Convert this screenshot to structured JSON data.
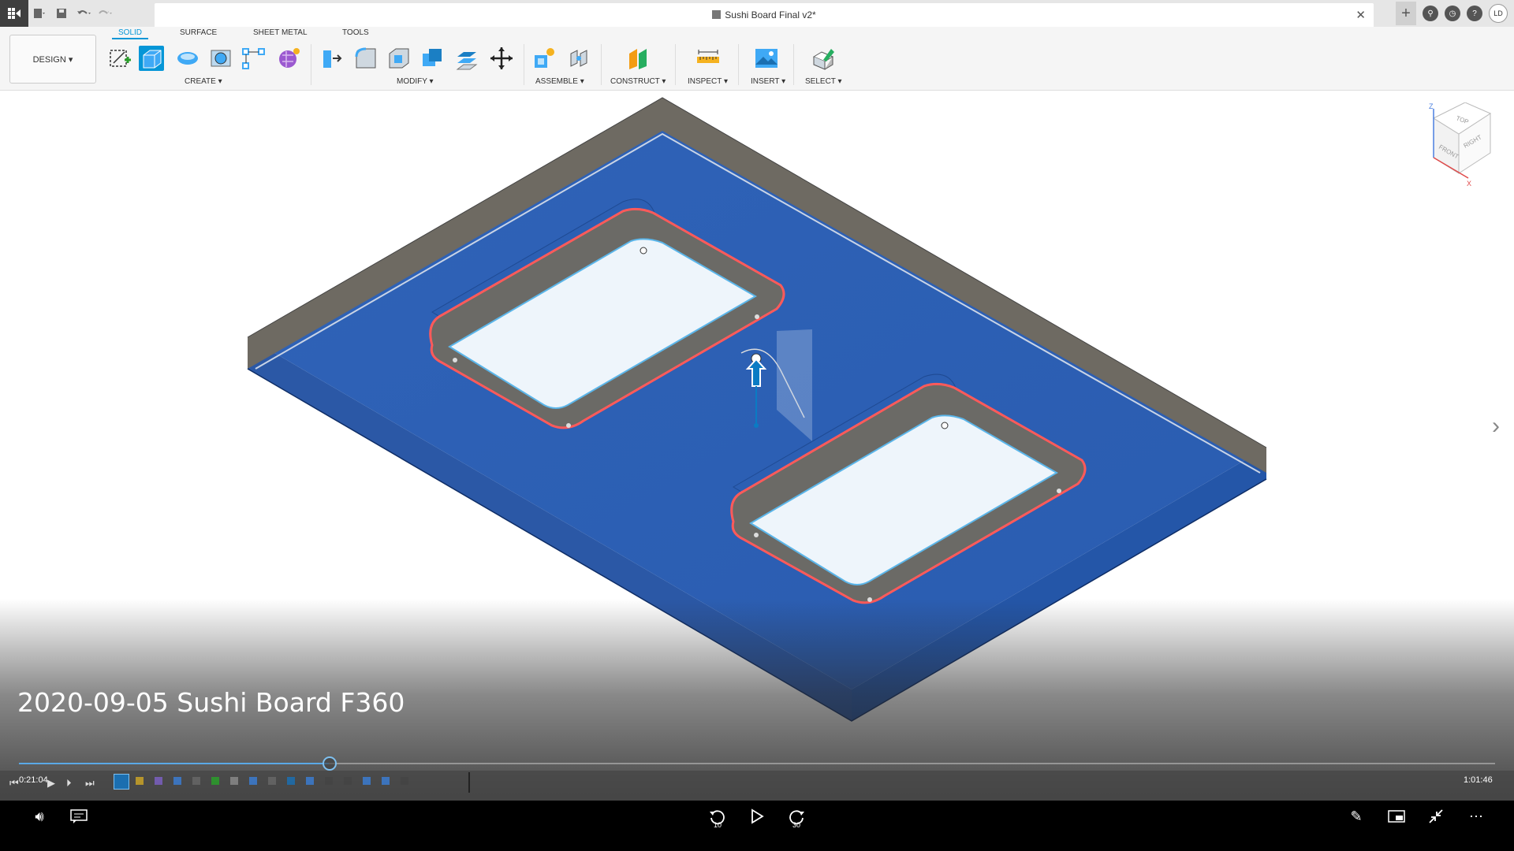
{
  "app": {
    "document_title": "Sushi Board Final v2*",
    "user_initials": "LD"
  },
  "toolbar": {
    "workspace_label": "DESIGN ▾",
    "tabs": [
      "SOLID",
      "SURFACE",
      "SHEET METAL",
      "TOOLS"
    ],
    "active_tab": "SOLID",
    "groups": [
      "CREATE ▾",
      "MODIFY ▾",
      "ASSEMBLE ▾",
      "CONSTRUCT ▾",
      "INSPECT ▾",
      "INSERT ▾",
      "SELECT ▾"
    ]
  },
  "viewport": {
    "body_color": "#2f63b8",
    "edge_color": "#6e6a62",
    "pocket_floor_color": "#eef5fb",
    "highlight_color": "#ff5a5a",
    "viewcube_faces": [
      "TOP",
      "FRONT",
      "RIGHT"
    ],
    "axis_labels": [
      "Z",
      "X"
    ]
  },
  "player": {
    "video_title": "2020-09-05 Sushi Board F360",
    "current_time": "0:21:04",
    "total_time": "1:01:46",
    "progress": 0.21,
    "skip_back_label": "10",
    "skip_forward_label": "30"
  },
  "icons": {
    "play": "play-icon",
    "volume": "volume-icon",
    "captions": "captions-icon",
    "edit": "pencil-icon",
    "miniplayer": "miniplayer-icon",
    "exit_fullscreen": "exit-fullscreen-icon",
    "more": "more-icon"
  }
}
